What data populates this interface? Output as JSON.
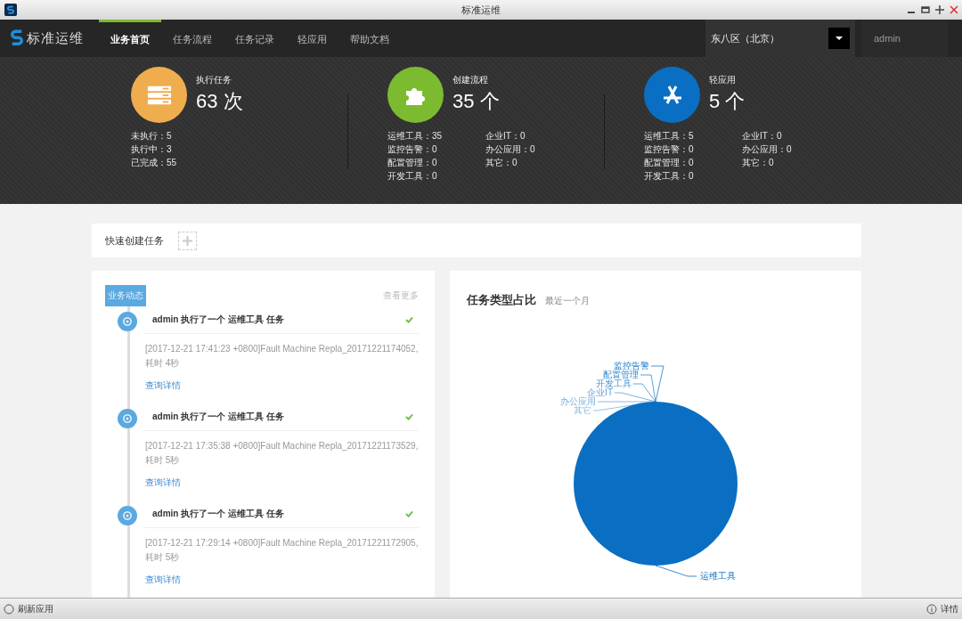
{
  "window": {
    "title": "标准运维"
  },
  "nav": {
    "logo": "标准运维",
    "items": [
      {
        "label": "业务首页",
        "selected": true
      },
      {
        "label": "任务流程",
        "selected": false
      },
      {
        "label": "任务记录",
        "selected": false
      },
      {
        "label": "轻应用",
        "selected": false
      },
      {
        "label": "帮助文档",
        "selected": false
      }
    ],
    "region": "东八区（北京）",
    "user": "admin"
  },
  "stats": [
    {
      "kind": "server",
      "color": "#f0ad4e",
      "title": "执行任务",
      "count": "63 次",
      "details": [
        "未执行：5",
        "执行中：3",
        "已完成：55"
      ]
    },
    {
      "kind": "puzzle",
      "color": "#7cbb2f",
      "title": "创建流程",
      "count": "35 个",
      "details": [
        "运维工具：35",
        "监控告警：0",
        "配置管理：0",
        "开发工具：0",
        "企业IT：0",
        "办公应用：0",
        "其它：0"
      ]
    },
    {
      "kind": "apps",
      "color": "#0a6fc2",
      "title": "轻应用",
      "count": "5 个",
      "details": [
        "运维工具：5",
        "监控告警：0",
        "配置管理：0",
        "开发工具：0",
        "企业IT：0",
        "办公应用：0",
        "其它：0"
      ]
    }
  ],
  "quick_create": {
    "label": "快速创建任务"
  },
  "activity": {
    "tag": "业务动态",
    "more": "查看更多",
    "items": [
      {
        "title": "admin 执行了一个 运维工具 任务",
        "done": true,
        "detail": "[2017-12-21 17:41:23 +0800]Fault Machine Repla_20171221174052, 耗时 4秒",
        "link": "查询详情"
      },
      {
        "title": "admin 执行了一个 运维工具 任务",
        "done": true,
        "detail": "[2017-12-21 17:35:38 +0800]Fault Machine Repla_20171221173529, 耗时 5秒",
        "link": "查询详情"
      },
      {
        "title": "admin 执行了一个 运维工具 任务",
        "done": true,
        "detail": "[2017-12-21 17:29:14 +0800]Fault Machine Repla_20171221172905, 耗时 5秒",
        "link": "查询详情"
      }
    ]
  },
  "chart_panel": {
    "title": "任务类型占比",
    "subtitle": "最近一个月",
    "chart_data": {
      "type": "pie",
      "categories": [
        "运维工具",
        "监控告警",
        "配置管理",
        "开发工具",
        "企业IT",
        "办公应用",
        "其它"
      ],
      "series": [
        {
          "color": "#0a6fc2",
          "values": [
            100,
            0,
            0,
            0,
            0,
            0,
            0
          ]
        }
      ]
    }
  },
  "status_bar": {
    "left": "刷新应用",
    "right": "详情"
  }
}
